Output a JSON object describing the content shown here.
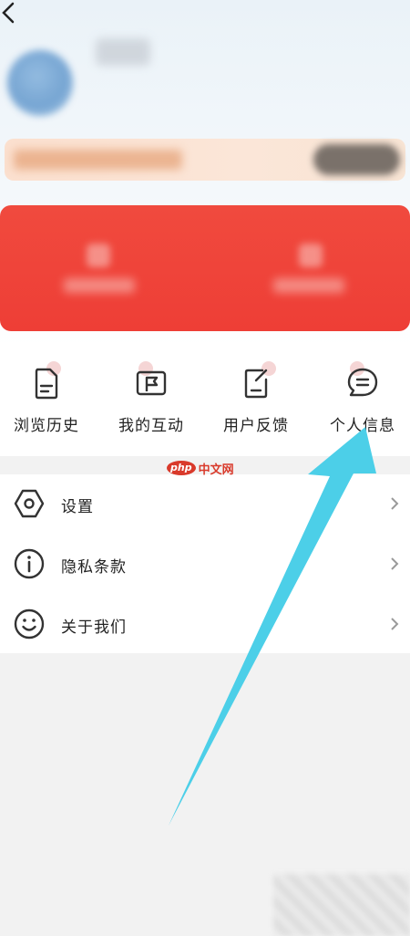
{
  "quick_actions": [
    {
      "label": "浏览历史",
      "icon": "document-icon"
    },
    {
      "label": "我的互动",
      "icon": "flag-message-icon"
    },
    {
      "label": "用户反馈",
      "icon": "edit-note-icon"
    },
    {
      "label": "个人信息",
      "icon": "chat-bubble-icon"
    }
  ],
  "menu": [
    {
      "label": "设置",
      "icon": "hexagon-settings-icon"
    },
    {
      "label": "隐私条款",
      "icon": "info-icon"
    },
    {
      "label": "关于我们",
      "icon": "smiley-icon"
    }
  ],
  "watermark": {
    "badge": "php",
    "text": "中文网"
  },
  "colors": {
    "accent_red": "#ee3e36",
    "annotation_arrow": "#4ccfe8"
  }
}
